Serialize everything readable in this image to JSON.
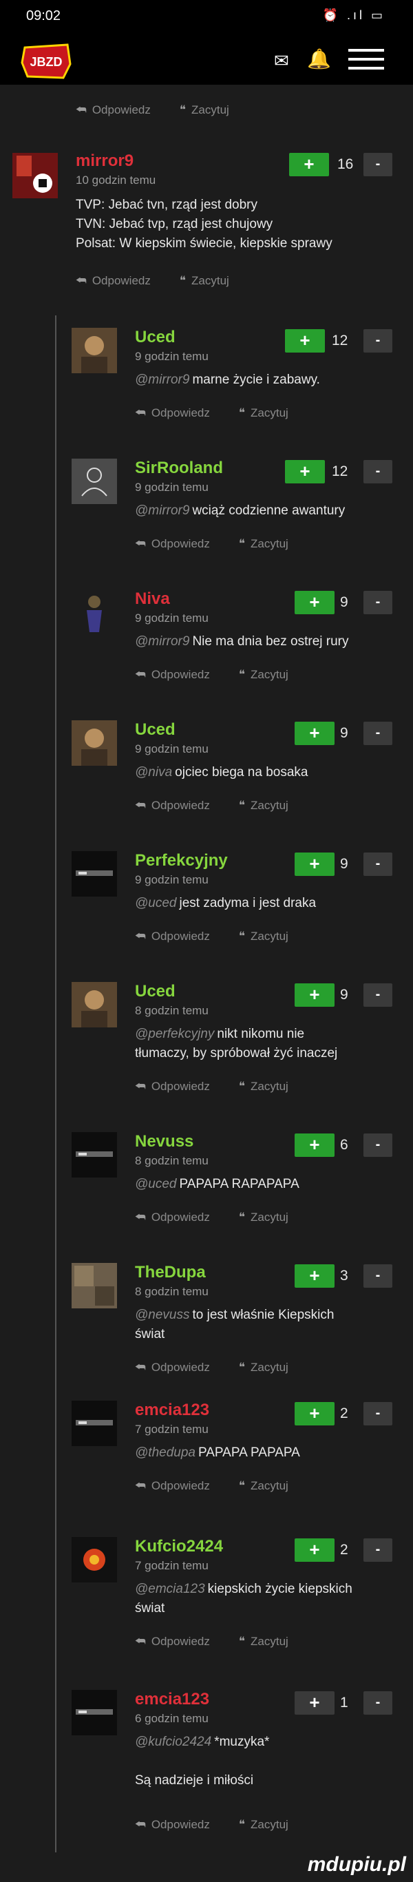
{
  "status": {
    "time": "09:02",
    "icons": "⏰ .ıl ▭"
  },
  "nav": {
    "logo_text": "JBZD"
  },
  "colors": {
    "accent_green": "#27a02e",
    "username_red": "#e0303a",
    "username_green": "#86d63e",
    "background": "#1c1c1c"
  },
  "actions": {
    "reply": "Odpowiedz",
    "quote": "Zacytuj"
  },
  "top_actions": {
    "reply": "Odpowiedz",
    "quote": "Zacytuj"
  },
  "mirror": {
    "username": "mirror9",
    "time": "10 godzin temu",
    "lines": [
      "TVP: Jebać tvn, rząd jest dobry",
      "TVN: Jebać tvp, rząd jest chujowy",
      "Polsat: W kiepskim świecie, kiepskie sprawy"
    ],
    "votes": "16"
  },
  "replies": [
    {
      "username": "Uced",
      "time": "9 godzin temu",
      "mention": "@mirror9",
      "text": "marne życie i zabawy.",
      "votes": "12"
    },
    {
      "username": "SirRooland",
      "time": "9 godzin temu",
      "mention": "@mirror9",
      "text": "wciąż codzienne awantury",
      "votes": "12"
    },
    {
      "username": "Niva",
      "time": "9 godzin temu",
      "mention": "@mirror9",
      "text": "Nie ma dnia bez ostrej rury",
      "votes": "9"
    },
    {
      "username": "Uced",
      "time": "9 godzin temu",
      "mention": "@niva",
      "text": "ojciec biega na bosaka",
      "votes": "9"
    },
    {
      "username": "Perfekcyjny",
      "time": "9 godzin temu",
      "mention": "@uced",
      "text": "jest zadyma i jest draka",
      "votes": "9"
    },
    {
      "username": "Uced",
      "time": "8 godzin temu",
      "mention": "@perfekcyjny",
      "text": "nikt nikomu nie",
      "text2": "tłumaczy, by spróbował żyć inaczej",
      "votes": "9"
    },
    {
      "username": "Nevuss",
      "time": "8 godzin temu",
      "mention": "@uced",
      "text": "PAPAPA RAPAPAPA",
      "votes": "6"
    },
    {
      "username": "TheDupa",
      "time": "8 godzin temu",
      "mention": "@nevuss",
      "text": "to jest właśnie Kiepskich",
      "text2": "świat",
      "votes": "3"
    },
    {
      "username": "emcia123",
      "time": "7 godzin temu",
      "mention": "@thedupa",
      "text": "PAPAPA PAPAPA",
      "votes": "2"
    },
    {
      "username": "Kufcio2424",
      "time": "7 godzin temu",
      "mention": "@emcia123",
      "text": "kiepskich życie kiepskich",
      "text2": "świat",
      "votes": "2"
    },
    {
      "username": "emcia123",
      "time": "6 godzin temu",
      "mention": "@kufcio2424",
      "text": "*muzyka*",
      "text3": "Są nadzieje i miłości",
      "votes": "1"
    }
  ],
  "watermark": "mdupiu.pl"
}
